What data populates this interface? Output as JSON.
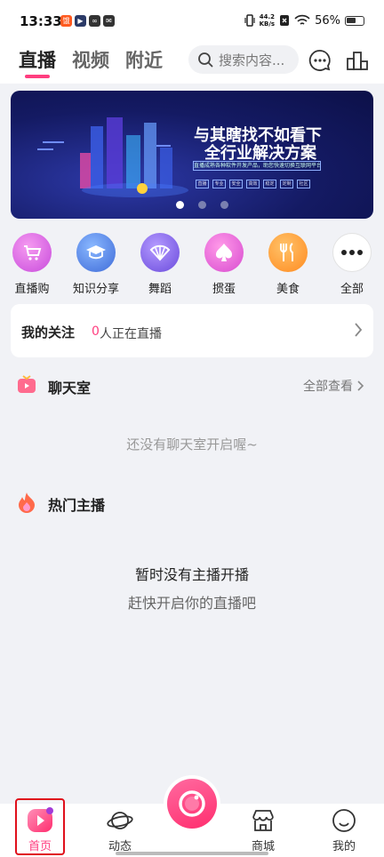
{
  "status_bar": {
    "time": "13:33",
    "network_speed_value": "44.2",
    "network_speed_unit": "KB/s",
    "battery": "56%"
  },
  "top_nav": {
    "tabs": [
      {
        "label": "直播"
      },
      {
        "label": "视频"
      },
      {
        "label": "附近"
      }
    ],
    "search_placeholder": "搜索内容..."
  },
  "banner": {
    "title_line1": "与其瞎找不如看下",
    "title_line2": "全行业解决方案",
    "subtitle": "直播成熟各种软件开发产品，助您快速切换互联网平台实现梦想",
    "tags": [
      "直播",
      "专业",
      "安全",
      "高效",
      "稳定",
      "定制",
      "社区"
    ],
    "page_count": 3,
    "active_page": 1
  },
  "categories": [
    {
      "label": "直播购",
      "icon": "cart-icon",
      "color": "#c84bdc"
    },
    {
      "label": "知识分享",
      "icon": "graduation-cap-icon",
      "color": "#3e6bd8"
    },
    {
      "label": "舞蹈",
      "icon": "fan-icon",
      "color": "#6a4bdc"
    },
    {
      "label": "掼蛋",
      "icon": "spade-icon",
      "color": "#d84bd0"
    },
    {
      "label": "美食",
      "icon": "fork-knife-icon",
      "color": "#ff8a1f"
    },
    {
      "label": "全部",
      "icon": "more-icon",
      "color": "#ffffff"
    }
  ],
  "follow": {
    "title": "我的关注",
    "live_count": "0",
    "live_status": "人正在直播"
  },
  "chatroom": {
    "title": "聊天室",
    "more_label": "全部查看",
    "empty_text": "还没有聊天室开启喔~"
  },
  "hot_hosts": {
    "title": "热门主播",
    "empty_line1": "暂时没有主播开播",
    "empty_line2": "赶快开启你的直播吧"
  },
  "bottom_nav": [
    {
      "label": "首页",
      "active": true
    },
    {
      "label": "动态"
    },
    {
      "label": "商城"
    },
    {
      "label": "我的"
    }
  ],
  "colors": {
    "accent": "#ff3d7f",
    "page_bg": "#f1f2f6"
  }
}
